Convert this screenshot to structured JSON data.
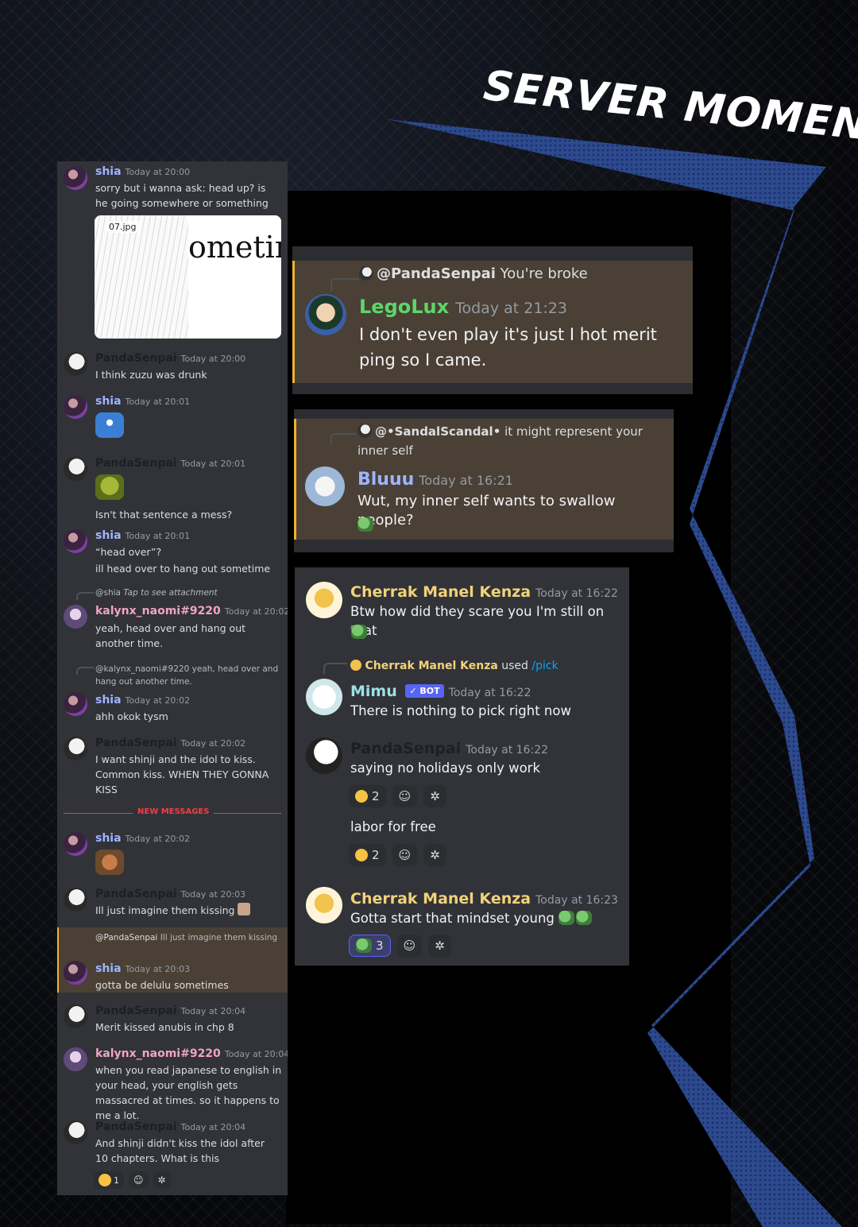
{
  "title": "SERVER MOMENTS",
  "left_panel": {
    "messages": [
      {
        "user": "shia",
        "time": "Today at 20:00",
        "text": "sorry but i wanna ask: head up? is he going somewhere or something",
        "attachment": "07.jpg",
        "attachment_text": "ometin"
      },
      {
        "user": "PandaSenpai",
        "time": "Today at 20:00",
        "text": "I think zuzu was drunk"
      },
      {
        "user": "shia",
        "time": "Today at 20:01",
        "text": ""
      },
      {
        "user": "PandaSenpai",
        "time": "Today at 20:01",
        "text": "Isn't that sentence a mess?"
      },
      {
        "user": "shia",
        "time": "Today at 20:01",
        "text": "“head over”?",
        "text2": "ill head over to hang out sometime"
      },
      {
        "reply_user": "@shia",
        "reply_text": "Tap to see attachment",
        "user": "kalynx_naomi#9220",
        "time": "Today at 20:02",
        "text": "yeah, head over and hang out another time."
      },
      {
        "reply_user": "@kalynx_naomi#9220",
        "reply_text": "yeah, head over and hang out another time.",
        "user": "shia",
        "time": "Today at 20:02",
        "text": "ahh okok tysm"
      },
      {
        "user": "PandaSenpai",
        "time": "Today at 20:02",
        "text": "I want shinji and the idol to kiss. Common kiss. WHEN THEY GONNA KISS"
      },
      {
        "user": "shia",
        "time": "Today at 20:02",
        "text": ""
      },
      {
        "user": "PandaSenpai",
        "time": "Today at 20:03",
        "text": "Ill just imagine them kissing"
      },
      {
        "reply_user": "@PandaSenpai",
        "reply_text": "Ill just imagine them kissing",
        "user": "shia",
        "time": "Today at 20:03",
        "text": "gotta be delulu sometimes"
      },
      {
        "user": "PandaSenpai",
        "time": "Today at 20:04",
        "text": "Merit kissed anubis in chp 8"
      },
      {
        "user": "kalynx_naomi#9220",
        "time": "Today at 20:04",
        "text": "when you read japanese to english in your head, your english gets massacred at times. so it happens to me a lot."
      },
      {
        "user": "PandaSenpai",
        "time": "Today at 20:04",
        "text": "And shinji didn't kiss the idol after 10 chapters. What is this",
        "reaction_count": "1"
      }
    ],
    "divider": "NEW MESSAGES"
  },
  "card1": {
    "reply_user": "@PandaSenpai",
    "reply_text": "You're broke",
    "user": "LegoLux",
    "time": "Today at 21:23",
    "text": "I don't even play it's just I hot merit ping so I came."
  },
  "card2": {
    "reply_user": "@•SandalScandal•",
    "reply_text": "it might represent your inner self",
    "user": "Bluuu",
    "time": "Today at 16:21",
    "text": "Wut, my inner self wants to swallow people?"
  },
  "card3": {
    "msg1": {
      "user": "Cherrak Manel Kenza",
      "time": "Today at 16:22",
      "text": "Btw how did they scare you I'm still on that"
    },
    "cmd": {
      "user": "Cherrak Manel Kenza",
      "used": "used",
      "command": "/pick"
    },
    "msg2": {
      "user": "Mimu",
      "badge": "BOT",
      "time": "Today at 16:22",
      "text": "There is nothing to pick right now"
    },
    "msg3": {
      "user": "PandaSenpai",
      "time": "Today at 16:22",
      "text": "saying no holidays only work",
      "text2": "labor for free",
      "react_count1": "2",
      "react_count2": "2"
    },
    "msg4": {
      "user": "Cherrak Manel Kenza",
      "time": "Today at 16:23",
      "text": "Gotta start that mindset young",
      "react_count": "3"
    }
  },
  "colors": {
    "ribbon": "#2d4a8f",
    "discord_bg": "#313338",
    "highlight": "#4a4035",
    "highlight_border": "#f0b232",
    "shia": "#9fb4ff",
    "kalynx": "#f0a3c9",
    "legolux": "#5dd66a",
    "bluuu": "#9fb4ff",
    "cherrak": "#f2d27a",
    "mimu": "#9ce0e6"
  }
}
